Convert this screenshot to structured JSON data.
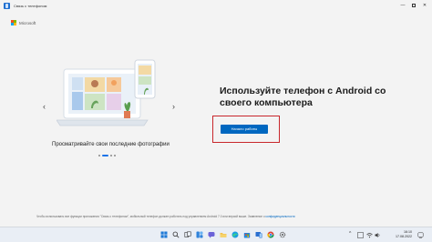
{
  "window": {
    "title": "Связь с телефоном",
    "minimize_glyph": "—",
    "close_glyph": "✕"
  },
  "brand": {
    "name": "Microsoft",
    "logo_colors": [
      "#f25022",
      "#7fba00",
      "#00a4ef",
      "#ffb900"
    ]
  },
  "carousel": {
    "prev_glyph": "‹",
    "next_glyph": "›",
    "caption": "Просматривайте свои последние фотографии",
    "slide_count": 4,
    "active_slide": 2
  },
  "main": {
    "headline": "Используйте телефон с Android со своего компьютера",
    "start_button_label": "Начало работы"
  },
  "footer": {
    "text": "Чтобы использовать все функции приложения \"Связь с телефоном\", мобильный телефон должен работать под управлением Android 7.0 или версий выше. Заявление о ",
    "link": "конфиденциальности"
  },
  "taskbar": {
    "apps": [
      "start-icon",
      "search-icon",
      "task-view-icon",
      "widgets-icon",
      "chat-icon",
      "file-explorer-icon",
      "edge-icon",
      "store-icon",
      "phone-link-icon",
      "chrome-icon",
      "settings-icon"
    ],
    "tray_chevron": "^",
    "clock_time": "16:10",
    "clock_date": "17.08.2022"
  },
  "colors": {
    "accent": "#0067c0",
    "highlight": "#c8262b",
    "background": "#f3f3f3"
  }
}
